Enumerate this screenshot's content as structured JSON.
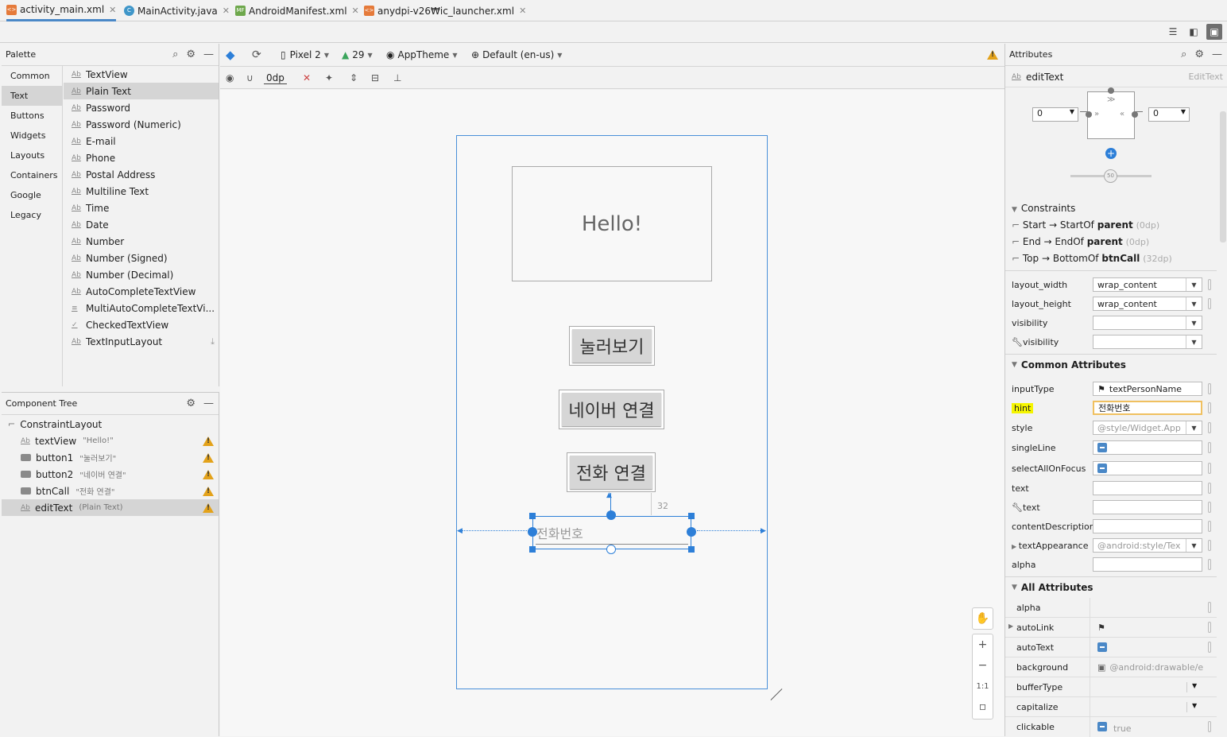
{
  "tabs": [
    {
      "label": "activity_main.xml",
      "icon": "xml-file-icon",
      "active": true
    },
    {
      "label": "MainActivity.java",
      "icon": "java-class-icon",
      "active": false
    },
    {
      "label": "AndroidManifest.xml",
      "icon": "manifest-file-icon",
      "active": false
    },
    {
      "label": "anydpi-v26₩ic_launcher.xml",
      "icon": "xml-file-icon",
      "active": false
    }
  ],
  "palette": {
    "title": "Palette",
    "categories": [
      "Common",
      "Text",
      "Buttons",
      "Widgets",
      "Layouts",
      "Containers",
      "Google",
      "Legacy"
    ],
    "selected_category": "Text",
    "items": [
      "TextView",
      "Plain Text",
      "Password",
      "Password (Numeric)",
      "E-mail",
      "Phone",
      "Postal Address",
      "Multiline Text",
      "Time",
      "Date",
      "Number",
      "Number (Signed)",
      "Number (Decimal)",
      "AutoCompleteTextView",
      "MultiAutoCompleteTextVi...",
      "CheckedTextView",
      "TextInputLayout"
    ],
    "selected_item": "Plain Text",
    "ab_icon": "Ab"
  },
  "component_tree": {
    "title": "Component Tree",
    "root": "ConstraintLayout",
    "children": [
      {
        "id": "textView",
        "desc": "\"Hello!\"",
        "type": "text"
      },
      {
        "id": "button1",
        "desc": "\"눌러보기\"",
        "type": "button"
      },
      {
        "id": "button2",
        "desc": "\"네이버 연결\"",
        "type": "button"
      },
      {
        "id": "btnCall",
        "desc": "\"전화 연결\"",
        "type": "button"
      },
      {
        "id": "editText",
        "desc": "(Plain Text)",
        "type": "text",
        "selected": true
      }
    ]
  },
  "toolbar": {
    "device": "Pixel 2",
    "api": "29",
    "theme": "AppTheme",
    "locale": "Default (en-us)",
    "margin": "0dp"
  },
  "canvas": {
    "hello_text": "Hello!",
    "button1": "눌러보기",
    "button2": "네이버 연결",
    "btn_call": "전화 연결",
    "edit_hint": "전화번호",
    "margin_label": "32",
    "zoom_ratio": "1:1"
  },
  "attributes": {
    "title": "Attributes",
    "widget_name": "editText",
    "widget_type": "EditText",
    "margin_start": "0",
    "margin_end": "0",
    "bias": "50",
    "constraints_title": "Constraints",
    "constraints": [
      {
        "side": "Start",
        "arrow": "→",
        "target": "StartOf",
        "bold": "parent",
        "dim": "(0dp)"
      },
      {
        "side": "End",
        "arrow": "→",
        "target": "EndOf",
        "bold": "parent",
        "dim": "(0dp)"
      },
      {
        "side": "Top",
        "arrow": "→",
        "target": "BottomOf",
        "bold": "btnCall",
        "dim": "(32dp)"
      }
    ],
    "layout": [
      {
        "label": "layout_width",
        "value": "wrap_content"
      },
      {
        "label": "layout_height",
        "value": "wrap_content"
      },
      {
        "label": "visibility",
        "value": ""
      },
      {
        "label": "visibility",
        "value": ""
      }
    ],
    "common_title": "Common Attributes",
    "common": [
      {
        "label": "inputType",
        "value": "textPersonName"
      },
      {
        "label": "hint",
        "value": "전화번호"
      },
      {
        "label": "style",
        "value": "@style/Widget.App"
      },
      {
        "label": "singleLine",
        "value": ""
      },
      {
        "label": "selectAllOnFocus",
        "value": ""
      },
      {
        "label": "text",
        "value": ""
      },
      {
        "label": "text",
        "value": ""
      },
      {
        "label": "contentDescription",
        "value": ""
      },
      {
        "label": "textAppearance",
        "value": "@android:style/Tex"
      },
      {
        "label": "alpha",
        "value": ""
      }
    ],
    "all_title": "All Attributes",
    "all": [
      {
        "label": "alpha",
        "value": ""
      },
      {
        "label": "autoLink",
        "value": ""
      },
      {
        "label": "autoText",
        "value": ""
      },
      {
        "label": "background",
        "value": "@android:drawable/e"
      },
      {
        "label": "bufferType",
        "value": ""
      },
      {
        "label": "capitalize",
        "value": ""
      },
      {
        "label": "clickable",
        "value": "true"
      }
    ],
    "hint_highlight": "#f5f500",
    "accent": "#2d7fd8"
  }
}
